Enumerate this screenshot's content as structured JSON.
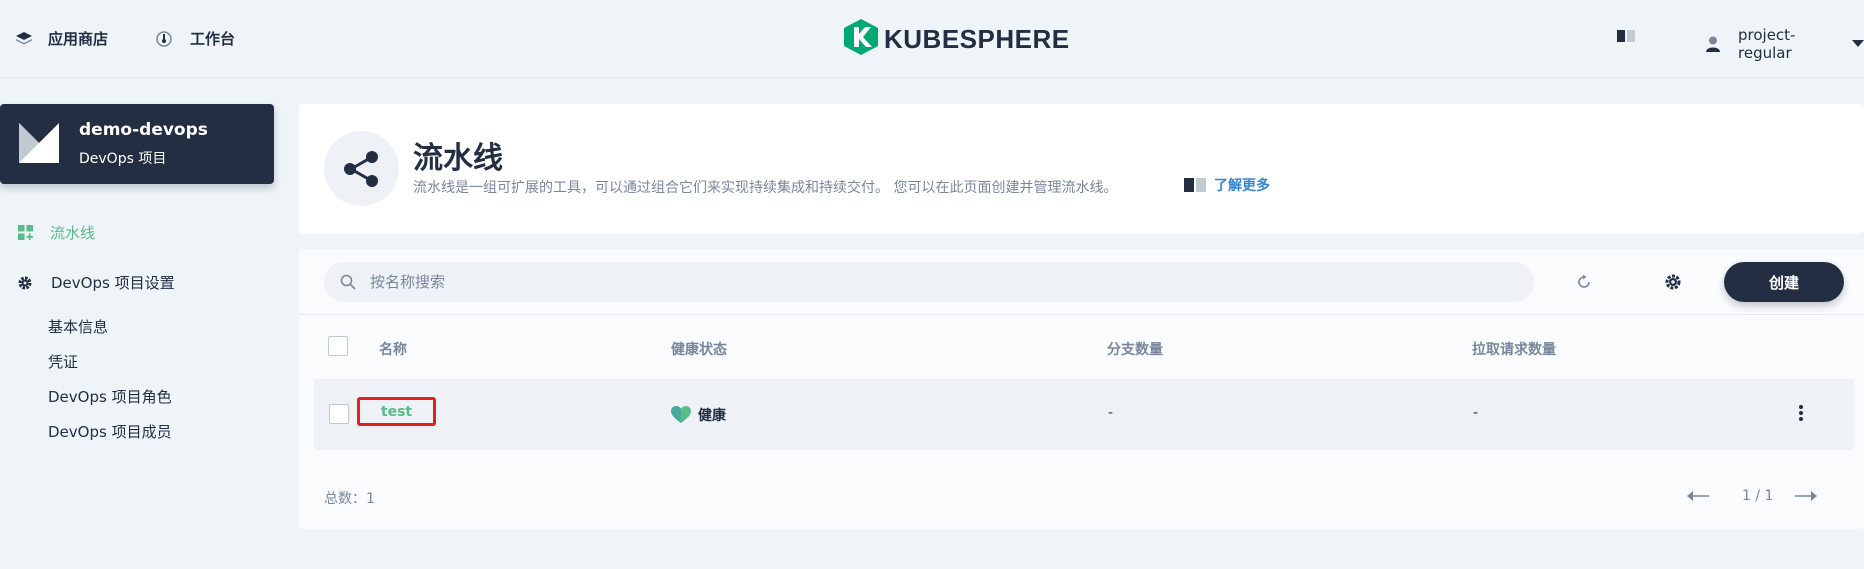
{
  "header": {
    "app_store": "应用商店",
    "workbench": "工作台",
    "logo_text": "KUBESPHERE",
    "username": "project-regular"
  },
  "sidebar": {
    "project_name": "demo-devops",
    "project_type": "DevOps 项目",
    "items": [
      {
        "label": "流水线",
        "icon": "grid-plus-icon",
        "active": true
      },
      {
        "label": "DevOps 项目设置",
        "icon": "gear-icon",
        "active": false
      }
    ],
    "settings_sub_items": [
      "基本信息",
      "凭证",
      "DevOps 项目角色",
      "DevOps 项目成员"
    ]
  },
  "banner": {
    "title": "流水线",
    "description": "流水线是一组可扩展的工具，可以通过组合它们来实现持续集成和持续交付。 您可以在此页面创建并管理流水线。",
    "learn_more": "了解更多",
    "icon": "pipeline-share-icon"
  },
  "toolbar": {
    "search_placeholder": "按名称搜索",
    "create_label": "创建"
  },
  "table": {
    "headers": [
      "名称",
      "健康状态",
      "分支数量",
      "拉取请求数量"
    ],
    "rows": [
      {
        "name": "test",
        "health": "健康",
        "branches": "-",
        "pull_requests": "-"
      }
    ]
  },
  "footer": {
    "total": "总数：1",
    "page": "1 / 1"
  },
  "colors": {
    "accent_green": "#55bc8a",
    "dark": "#242e42",
    "highlight_red": "#e0201d"
  }
}
